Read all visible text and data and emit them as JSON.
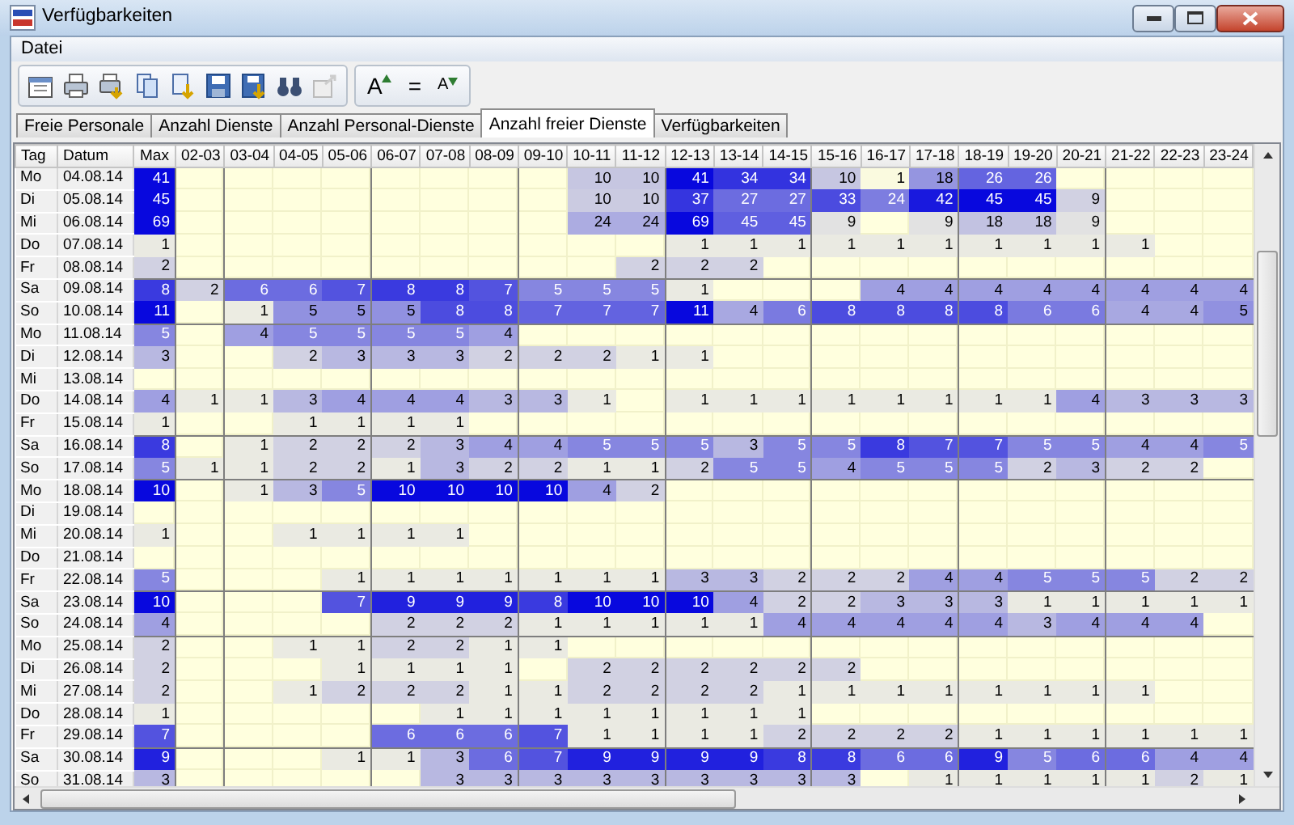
{
  "window": {
    "title": "Verfügbarkeiten"
  },
  "menu": [
    "Datei"
  ],
  "font_buttons": [
    "A",
    "=",
    "A"
  ],
  "tabs": [
    {
      "label": "Freie Personale",
      "selected": false
    },
    {
      "label": "Anzahl Dienste",
      "selected": false
    },
    {
      "label": "Anzahl Personal-Dienste",
      "selected": false
    },
    {
      "label": "Anzahl freier Dienste",
      "selected": true
    },
    {
      "label": "Verfügbarkeiten",
      "selected": false
    }
  ],
  "table": {
    "columns": [
      "Tag",
      "Datum",
      "Max",
      "02-03",
      "03-04",
      "04-05",
      "05-06",
      "06-07",
      "07-08",
      "08-09",
      "09-10",
      "10-11",
      "11-12",
      "12-13",
      "13-14",
      "14-15",
      "15-16",
      "16-17",
      "17-18",
      "18-19",
      "19-20",
      "20-21",
      "21-22",
      "22-23",
      "23-24"
    ],
    "rows": [
      {
        "day": "Mo",
        "date": "04.08.14",
        "max": "41",
        "hours": [
          {
            "empty": true
          },
          {
            "empty": true
          },
          {
            "empty": true
          },
          {
            "empty": true
          },
          {
            "empty": true
          },
          {
            "empty": true
          },
          {
            "empty": true
          },
          {
            "empty": true
          },
          {
            "value": "10"
          },
          {
            "value": "10"
          },
          {
            "value": "41"
          },
          {
            "value": "34"
          },
          {
            "value": "34"
          },
          {
            "value": "10"
          },
          {
            "value": "1"
          },
          {
            "value": "18"
          },
          {
            "value": "26"
          },
          {
            "value": "26"
          },
          {
            "empty": true
          },
          {
            "empty": true
          },
          {
            "empty": true
          },
          {
            "empty": true
          }
        ]
      },
      {
        "day": "Di",
        "date": "05.08.14",
        "max": "45",
        "hours": [
          {
            "empty": true
          },
          {
            "empty": true
          },
          {
            "empty": true
          },
          {
            "empty": true
          },
          {
            "empty": true
          },
          {
            "empty": true
          },
          {
            "empty": true
          },
          {
            "empty": true
          },
          {
            "value": "10"
          },
          {
            "value": "10"
          },
          {
            "value": "37"
          },
          {
            "value": "27"
          },
          {
            "value": "27"
          },
          {
            "value": "33"
          },
          {
            "value": "24"
          },
          {
            "value": "42"
          },
          {
            "value": "45"
          },
          {
            "value": "45"
          },
          {
            "value": "9"
          },
          {
            "empty": true
          },
          {
            "empty": true
          },
          {
            "empty": true
          }
        ]
      },
      {
        "day": "Mi",
        "date": "06.08.14",
        "max": "69",
        "hours": [
          {
            "empty": true
          },
          {
            "empty": true
          },
          {
            "empty": true
          },
          {
            "empty": true
          },
          {
            "empty": true
          },
          {
            "empty": true
          },
          {
            "empty": true
          },
          {
            "empty": true
          },
          {
            "value": "24"
          },
          {
            "value": "24"
          },
          {
            "value": "69"
          },
          {
            "value": "45"
          },
          {
            "value": "45"
          },
          {
            "value": "9"
          },
          {
            "empty": true
          },
          {
            "value": "9"
          },
          {
            "value": "18"
          },
          {
            "value": "18"
          },
          {
            "value": "9"
          },
          {
            "empty": true
          },
          {
            "empty": true
          },
          {
            "empty": true
          }
        ]
      },
      {
        "day": "Do",
        "date": "07.08.14",
        "max": "1",
        "hours": [
          {
            "empty": true
          },
          {
            "empty": true
          },
          {
            "empty": true
          },
          {
            "empty": true
          },
          {
            "empty": true
          },
          {
            "empty": true
          },
          {
            "empty": true
          },
          {
            "empty": true
          },
          {
            "empty": true
          },
          {
            "empty": true
          },
          {
            "value": "1"
          },
          {
            "value": "1"
          },
          {
            "value": "1"
          },
          {
            "value": "1"
          },
          {
            "value": "1"
          },
          {
            "value": "1"
          },
          {
            "value": "1"
          },
          {
            "value": "1"
          },
          {
            "value": "1"
          },
          {
            "value": "1"
          },
          {
            "empty": true
          },
          {
            "empty": true
          }
        ]
      },
      {
        "day": "Fr",
        "date": "08.08.14",
        "max": "2",
        "hours": [
          {
            "empty": true
          },
          {
            "empty": true
          },
          {
            "empty": true
          },
          {
            "empty": true
          },
          {
            "empty": true
          },
          {
            "empty": true
          },
          {
            "empty": true
          },
          {
            "empty": true
          },
          {
            "empty": true
          },
          {
            "value": "2"
          },
          {
            "value": "2"
          },
          {
            "value": "2"
          },
          {
            "empty": true
          },
          {
            "empty": true
          },
          {
            "empty": true
          },
          {
            "empty": true
          },
          {
            "empty": true
          },
          {
            "empty": true
          },
          {
            "empty": true
          },
          {
            "empty": true
          },
          {
            "empty": true
          },
          {
            "empty": true
          }
        ]
      },
      {
        "day": "Sa",
        "date": "09.08.14",
        "max": "8",
        "hours": [
          {
            "value": "2"
          },
          {
            "value": "6"
          },
          {
            "value": "6"
          },
          {
            "value": "7"
          },
          {
            "value": "8"
          },
          {
            "value": "8"
          },
          {
            "value": "7"
          },
          {
            "value": "5"
          },
          {
            "value": "5"
          },
          {
            "value": "5"
          },
          {
            "value": "1"
          },
          {
            "empty": true
          },
          {
            "empty": true
          },
          {
            "empty": true
          },
          {
            "value": "4"
          },
          {
            "value": "4"
          },
          {
            "value": "4"
          },
          {
            "value": "4"
          },
          {
            "value": "4"
          },
          {
            "value": "4"
          },
          {
            "value": "4"
          },
          {
            "value": "4"
          }
        ]
      },
      {
        "day": "So",
        "date": "10.08.14",
        "max": "11",
        "hours": [
          {
            "empty": true
          },
          {
            "value": "1"
          },
          {
            "value": "5"
          },
          {
            "value": "5"
          },
          {
            "value": "5"
          },
          {
            "value": "8"
          },
          {
            "value": "8"
          },
          {
            "value": "7"
          },
          {
            "value": "7"
          },
          {
            "value": "7"
          },
          {
            "value": "11"
          },
          {
            "value": "4"
          },
          {
            "value": "6"
          },
          {
            "value": "8"
          },
          {
            "value": "8"
          },
          {
            "value": "8"
          },
          {
            "value": "8"
          },
          {
            "value": "6"
          },
          {
            "value": "6"
          },
          {
            "value": "4"
          },
          {
            "value": "4"
          },
          {
            "value": "5"
          }
        ]
      },
      {
        "day": "Mo",
        "date": "11.08.14",
        "max": "5",
        "hours": [
          {
            "empty": true
          },
          {
            "value": "4"
          },
          {
            "value": "5"
          },
          {
            "value": "5"
          },
          {
            "value": "5"
          },
          {
            "value": "5"
          },
          {
            "value": "4"
          },
          {
            "empty": true
          },
          {
            "empty": true
          },
          {
            "empty": true
          },
          {
            "empty": true
          },
          {
            "empty": true
          },
          {
            "empty": true
          },
          {
            "empty": true
          },
          {
            "empty": true
          },
          {
            "empty": true
          },
          {
            "empty": true
          },
          {
            "empty": true
          },
          {
            "empty": true
          },
          {
            "empty": true
          },
          {
            "empty": true
          },
          {
            "empty": true
          }
        ]
      },
      {
        "day": "Di",
        "date": "12.08.14",
        "max": "3",
        "hours": [
          {
            "empty": true
          },
          {
            "empty": true
          },
          {
            "value": "2"
          },
          {
            "value": "3"
          },
          {
            "value": "3"
          },
          {
            "value": "3"
          },
          {
            "value": "2"
          },
          {
            "value": "2"
          },
          {
            "value": "2"
          },
          {
            "value": "1"
          },
          {
            "value": "1"
          },
          {
            "empty": true
          },
          {
            "empty": true
          },
          {
            "empty": true
          },
          {
            "empty": true
          },
          {
            "empty": true
          },
          {
            "empty": true
          },
          {
            "empty": true
          },
          {
            "empty": true
          },
          {
            "empty": true
          },
          {
            "empty": true
          },
          {
            "empty": true
          }
        ]
      },
      {
        "day": "Mi",
        "date": "13.08.14",
        "max_empty": true,
        "hours": [
          {
            "empty": true
          },
          {
            "empty": true
          },
          {
            "empty": true
          },
          {
            "empty": true
          },
          {
            "empty": true
          },
          {
            "empty": true
          },
          {
            "empty": true
          },
          {
            "empty": true
          },
          {
            "empty": true
          },
          {
            "empty": true
          },
          {
            "empty": true
          },
          {
            "empty": true
          },
          {
            "empty": true
          },
          {
            "empty": true
          },
          {
            "empty": true
          },
          {
            "empty": true
          },
          {
            "empty": true
          },
          {
            "empty": true
          },
          {
            "empty": true
          },
          {
            "empty": true
          },
          {
            "empty": true
          },
          {
            "empty": true
          }
        ]
      },
      {
        "day": "Do",
        "date": "14.08.14",
        "max": "4",
        "hours": [
          {
            "value": "1"
          },
          {
            "value": "1"
          },
          {
            "value": "3"
          },
          {
            "value": "4"
          },
          {
            "value": "4"
          },
          {
            "value": "4"
          },
          {
            "value": "3"
          },
          {
            "value": "3"
          },
          {
            "value": "1"
          },
          {
            "empty": true
          },
          {
            "value": "1"
          },
          {
            "value": "1"
          },
          {
            "value": "1"
          },
          {
            "value": "1"
          },
          {
            "value": "1"
          },
          {
            "value": "1"
          },
          {
            "value": "1"
          },
          {
            "value": "1"
          },
          {
            "value": "4"
          },
          {
            "value": "3"
          },
          {
            "value": "3"
          },
          {
            "value": "3"
          }
        ]
      },
      {
        "day": "Fr",
        "date": "15.08.14",
        "max": "1",
        "hours": [
          {
            "empty": true
          },
          {
            "empty": true
          },
          {
            "value": "1"
          },
          {
            "value": "1"
          },
          {
            "value": "1"
          },
          {
            "value": "1"
          },
          {
            "empty": true
          },
          {
            "empty": true
          },
          {
            "empty": true
          },
          {
            "empty": true
          },
          {
            "empty": true
          },
          {
            "empty": true
          },
          {
            "empty": true
          },
          {
            "empty": true
          },
          {
            "empty": true
          },
          {
            "empty": true
          },
          {
            "empty": true
          },
          {
            "empty": true
          },
          {
            "empty": true
          },
          {
            "empty": true
          },
          {
            "empty": true
          },
          {
            "empty": true
          }
        ]
      },
      {
        "day": "Sa",
        "date": "16.08.14",
        "max": "8",
        "hours": [
          {
            "empty": true
          },
          {
            "value": "1"
          },
          {
            "value": "2"
          },
          {
            "value": "2"
          },
          {
            "value": "2"
          },
          {
            "value": "3"
          },
          {
            "value": "4"
          },
          {
            "value": "4"
          },
          {
            "value": "5"
          },
          {
            "value": "5"
          },
          {
            "value": "5"
          },
          {
            "value": "3"
          },
          {
            "value": "5"
          },
          {
            "value": "5"
          },
          {
            "value": "8"
          },
          {
            "value": "7"
          },
          {
            "value": "7"
          },
          {
            "value": "5"
          },
          {
            "value": "5"
          },
          {
            "value": "4"
          },
          {
            "value": "4"
          },
          {
            "value": "5"
          }
        ]
      },
      {
        "day": "So",
        "date": "17.08.14",
        "max": "5",
        "hours": [
          {
            "value": "1"
          },
          {
            "value": "1"
          },
          {
            "value": "2"
          },
          {
            "value": "2"
          },
          {
            "value": "1"
          },
          {
            "value": "3"
          },
          {
            "value": "2"
          },
          {
            "value": "2"
          },
          {
            "value": "1"
          },
          {
            "value": "1"
          },
          {
            "value": "2"
          },
          {
            "value": "5"
          },
          {
            "value": "5"
          },
          {
            "value": "4"
          },
          {
            "value": "5"
          },
          {
            "value": "5"
          },
          {
            "value": "5"
          },
          {
            "value": "2"
          },
          {
            "value": "3"
          },
          {
            "value": "2"
          },
          {
            "value": "2"
          },
          {
            "empty": true
          }
        ]
      },
      {
        "day": "Mo",
        "date": "18.08.14",
        "max": "10",
        "hours": [
          {
            "empty": true
          },
          {
            "value": "1"
          },
          {
            "value": "3"
          },
          {
            "value": "5"
          },
          {
            "value": "10"
          },
          {
            "value": "10"
          },
          {
            "value": "10"
          },
          {
            "value": "10"
          },
          {
            "value": "4"
          },
          {
            "value": "2"
          },
          {
            "empty": true
          },
          {
            "empty": true
          },
          {
            "empty": true
          },
          {
            "empty": true
          },
          {
            "empty": true
          },
          {
            "empty": true
          },
          {
            "empty": true
          },
          {
            "empty": true
          },
          {
            "empty": true
          },
          {
            "empty": true
          },
          {
            "empty": true
          },
          {
            "empty": true
          }
        ]
      },
      {
        "day": "Di",
        "date": "19.08.14",
        "max_empty": true,
        "hours": [
          {
            "empty": true
          },
          {
            "empty": true
          },
          {
            "empty": true
          },
          {
            "empty": true
          },
          {
            "empty": true
          },
          {
            "empty": true
          },
          {
            "empty": true
          },
          {
            "empty": true
          },
          {
            "empty": true
          },
          {
            "empty": true
          },
          {
            "empty": true
          },
          {
            "empty": true
          },
          {
            "empty": true
          },
          {
            "empty": true
          },
          {
            "empty": true
          },
          {
            "empty": true
          },
          {
            "empty": true
          },
          {
            "empty": true
          },
          {
            "empty": true
          },
          {
            "empty": true
          },
          {
            "empty": true
          },
          {
            "empty": true
          }
        ]
      },
      {
        "day": "Mi",
        "date": "20.08.14",
        "max": "1",
        "hours": [
          {
            "empty": true
          },
          {
            "empty": true
          },
          {
            "value": "1"
          },
          {
            "value": "1"
          },
          {
            "value": "1"
          },
          {
            "value": "1"
          },
          {
            "empty": true
          },
          {
            "empty": true
          },
          {
            "empty": true
          },
          {
            "empty": true
          },
          {
            "empty": true
          },
          {
            "empty": true
          },
          {
            "empty": true
          },
          {
            "empty": true
          },
          {
            "empty": true
          },
          {
            "empty": true
          },
          {
            "empty": true
          },
          {
            "empty": true
          },
          {
            "empty": true
          },
          {
            "empty": true
          },
          {
            "empty": true
          },
          {
            "empty": true
          }
        ]
      },
      {
        "day": "Do",
        "date": "21.08.14",
        "max_empty": true,
        "hours": [
          {
            "empty": true
          },
          {
            "empty": true
          },
          {
            "empty": true
          },
          {
            "empty": true
          },
          {
            "empty": true
          },
          {
            "empty": true
          },
          {
            "empty": true
          },
          {
            "empty": true
          },
          {
            "empty": true
          },
          {
            "empty": true
          },
          {
            "empty": true
          },
          {
            "empty": true
          },
          {
            "empty": true
          },
          {
            "empty": true
          },
          {
            "empty": true
          },
          {
            "empty": true
          },
          {
            "empty": true
          },
          {
            "empty": true
          },
          {
            "empty": true
          },
          {
            "empty": true
          },
          {
            "empty": true
          },
          {
            "empty": true
          }
        ]
      },
      {
        "day": "Fr",
        "date": "22.08.14",
        "max": "5",
        "hours": [
          {
            "empty": true
          },
          {
            "empty": true
          },
          {
            "empty": true
          },
          {
            "value": "1"
          },
          {
            "value": "1"
          },
          {
            "value": "1"
          },
          {
            "value": "1"
          },
          {
            "value": "1"
          },
          {
            "value": "1"
          },
          {
            "value": "1"
          },
          {
            "value": "3"
          },
          {
            "value": "3"
          },
          {
            "value": "2"
          },
          {
            "value": "2"
          },
          {
            "value": "2"
          },
          {
            "value": "4"
          },
          {
            "value": "4"
          },
          {
            "value": "5"
          },
          {
            "value": "5"
          },
          {
            "value": "5"
          },
          {
            "value": "2"
          },
          {
            "value": "2"
          }
        ]
      },
      {
        "day": "Sa",
        "date": "23.08.14",
        "max": "10",
        "hours": [
          {
            "empty": true
          },
          {
            "empty": true
          },
          {
            "empty": true
          },
          {
            "value": "7"
          },
          {
            "value": "9"
          },
          {
            "value": "9"
          },
          {
            "value": "9"
          },
          {
            "value": "8"
          },
          {
            "value": "10"
          },
          {
            "value": "10"
          },
          {
            "value": "10"
          },
          {
            "value": "4"
          },
          {
            "value": "2"
          },
          {
            "value": "2"
          },
          {
            "value": "3"
          },
          {
            "value": "3"
          },
          {
            "value": "3"
          },
          {
            "value": "1"
          },
          {
            "value": "1"
          },
          {
            "value": "1"
          },
          {
            "value": "1"
          },
          {
            "value": "1"
          }
        ]
      },
      {
        "day": "So",
        "date": "24.08.14",
        "max": "4",
        "hours": [
          {
            "empty": true
          },
          {
            "empty": true
          },
          {
            "empty": true
          },
          {
            "empty": true
          },
          {
            "value": "2"
          },
          {
            "value": "2"
          },
          {
            "value": "2"
          },
          {
            "value": "1"
          },
          {
            "value": "1"
          },
          {
            "value": "1"
          },
          {
            "value": "1"
          },
          {
            "value": "1"
          },
          {
            "value": "4"
          },
          {
            "value": "4"
          },
          {
            "value": "4"
          },
          {
            "value": "4"
          },
          {
            "value": "4"
          },
          {
            "value": "3"
          },
          {
            "value": "4"
          },
          {
            "value": "4"
          },
          {
            "value": "4"
          },
          {
            "empty": true
          }
        ]
      },
      {
        "day": "Mo",
        "date": "25.08.14",
        "max": "2",
        "hours": [
          {
            "empty": true
          },
          {
            "empty": true
          },
          {
            "value": "1"
          },
          {
            "value": "1"
          },
          {
            "value": "2"
          },
          {
            "value": "2"
          },
          {
            "value": "1"
          },
          {
            "value": "1"
          },
          {
            "empty": true
          },
          {
            "empty": true
          },
          {
            "empty": true
          },
          {
            "empty": true
          },
          {
            "empty": true
          },
          {
            "empty": true
          },
          {
            "empty": true
          },
          {
            "empty": true
          },
          {
            "empty": true
          },
          {
            "empty": true
          },
          {
            "empty": true
          },
          {
            "empty": true
          },
          {
            "empty": true
          },
          {
            "empty": true
          }
        ]
      },
      {
        "day": "Di",
        "date": "26.08.14",
        "max": "2",
        "hours": [
          {
            "empty": true
          },
          {
            "empty": true
          },
          {
            "empty": true
          },
          {
            "value": "1"
          },
          {
            "value": "1"
          },
          {
            "value": "1"
          },
          {
            "value": "1"
          },
          {
            "empty": true
          },
          {
            "value": "2"
          },
          {
            "value": "2"
          },
          {
            "value": "2"
          },
          {
            "value": "2"
          },
          {
            "value": "2"
          },
          {
            "value": "2"
          },
          {
            "empty": true
          },
          {
            "empty": true
          },
          {
            "empty": true
          },
          {
            "empty": true
          },
          {
            "empty": true
          },
          {
            "empty": true
          },
          {
            "empty": true
          },
          {
            "empty": true
          }
        ]
      },
      {
        "day": "Mi",
        "date": "27.08.14",
        "max": "2",
        "hours": [
          {
            "empty": true
          },
          {
            "empty": true
          },
          {
            "value": "1"
          },
          {
            "value": "2"
          },
          {
            "value": "2"
          },
          {
            "value": "2"
          },
          {
            "value": "1"
          },
          {
            "value": "1"
          },
          {
            "value": "2"
          },
          {
            "value": "2"
          },
          {
            "value": "2"
          },
          {
            "value": "2"
          },
          {
            "value": "1"
          },
          {
            "value": "1"
          },
          {
            "value": "1"
          },
          {
            "value": "1"
          },
          {
            "value": "1"
          },
          {
            "value": "1"
          },
          {
            "value": "1"
          },
          {
            "value": "1"
          },
          {
            "empty": true
          },
          {
            "empty": true
          }
        ]
      },
      {
        "day": "Do",
        "date": "28.08.14",
        "max": "1",
        "hours": [
          {
            "empty": true
          },
          {
            "empty": true
          },
          {
            "empty": true
          },
          {
            "empty": true
          },
          {
            "empty": true
          },
          {
            "value": "1"
          },
          {
            "value": "1"
          },
          {
            "value": "1"
          },
          {
            "value": "1"
          },
          {
            "value": "1"
          },
          {
            "value": "1"
          },
          {
            "value": "1"
          },
          {
            "value": "1"
          },
          {
            "empty": true
          },
          {
            "empty": true
          },
          {
            "empty": true
          },
          {
            "empty": true
          },
          {
            "empty": true
          },
          {
            "empty": true
          },
          {
            "empty": true
          },
          {
            "empty": true
          },
          {
            "empty": true
          }
        ]
      },
      {
        "day": "Fr",
        "date": "29.08.14",
        "max": "7",
        "hours": [
          {
            "empty": true
          },
          {
            "empty": true
          },
          {
            "empty": true
          },
          {
            "empty": true
          },
          {
            "value": "6"
          },
          {
            "value": "6"
          },
          {
            "value": "6"
          },
          {
            "value": "7"
          },
          {
            "value": "1"
          },
          {
            "value": "1"
          },
          {
            "value": "1"
          },
          {
            "value": "1"
          },
          {
            "value": "2"
          },
          {
            "value": "2"
          },
          {
            "value": "2"
          },
          {
            "value": "2"
          },
          {
            "value": "1"
          },
          {
            "value": "1"
          },
          {
            "value": "1"
          },
          {
            "value": "1"
          },
          {
            "value": "1"
          },
          {
            "value": "1"
          }
        ]
      },
      {
        "day": "Sa",
        "date": "30.08.14",
        "max": "9",
        "hours": [
          {
            "empty": true
          },
          {
            "empty": true
          },
          {
            "empty": true
          },
          {
            "value": "1"
          },
          {
            "value": "1"
          },
          {
            "value": "3"
          },
          {
            "value": "6"
          },
          {
            "value": "7"
          },
          {
            "value": "9"
          },
          {
            "value": "9"
          },
          {
            "value": "9"
          },
          {
            "value": "9"
          },
          {
            "value": "8"
          },
          {
            "value": "8"
          },
          {
            "value": "6"
          },
          {
            "value": "6"
          },
          {
            "value": "9"
          },
          {
            "value": "5"
          },
          {
            "value": "6"
          },
          {
            "value": "6"
          },
          {
            "value": "4"
          },
          {
            "value": "4"
          }
        ]
      },
      {
        "day": "So",
        "date": "31.08.14",
        "max": "3",
        "hours": [
          {
            "empty": true
          },
          {
            "empty": true
          },
          {
            "empty": true
          },
          {
            "empty": true
          },
          {
            "empty": true
          },
          {
            "value": "3"
          },
          {
            "value": "3"
          },
          {
            "value": "3"
          },
          {
            "value": "3"
          },
          {
            "value": "3"
          },
          {
            "value": "3"
          },
          {
            "value": "3"
          },
          {
            "value": "3"
          },
          {
            "value": "3"
          },
          {
            "empty": true
          },
          {
            "value": "1"
          },
          {
            "value": "1"
          },
          {
            "value": "1"
          },
          {
            "value": "1"
          },
          {
            "value": "1"
          },
          {
            "value": "2"
          },
          {
            "value": "1"
          }
        ]
      }
    ]
  }
}
